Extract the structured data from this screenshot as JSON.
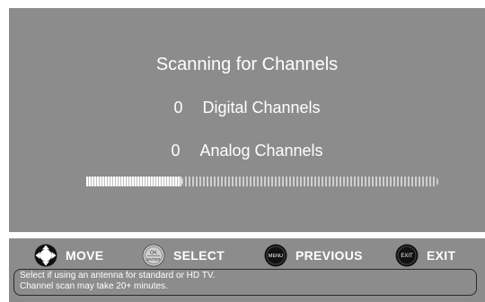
{
  "scan": {
    "title": "Scanning for Channels",
    "digital_count": "0",
    "digital_label": "Digital Channels",
    "analog_count": "0",
    "analog_label": "Analog Channels",
    "progress": 0.27
  },
  "legend": {
    "move": {
      "label": "MOVE",
      "icon": "dpad-icon"
    },
    "select": {
      "label": "SELECT",
      "icon": "ok-enter-icon",
      "icon_text_top": "OK",
      "icon_text_bottom": "ENTER"
    },
    "previous": {
      "label": "PREVIOUS",
      "icon": "menu-button-icon",
      "icon_text": "MENU"
    },
    "exit": {
      "label": "EXIT",
      "icon": "exit-button-icon",
      "icon_text": "EXIT"
    }
  },
  "help": {
    "line1": "Select if using an antenna for standard or HD TV.",
    "line2": "Channel scan may take 20+ minutes."
  },
  "colors": {
    "panel": "#8c8c8c",
    "text": "#ffffff"
  }
}
